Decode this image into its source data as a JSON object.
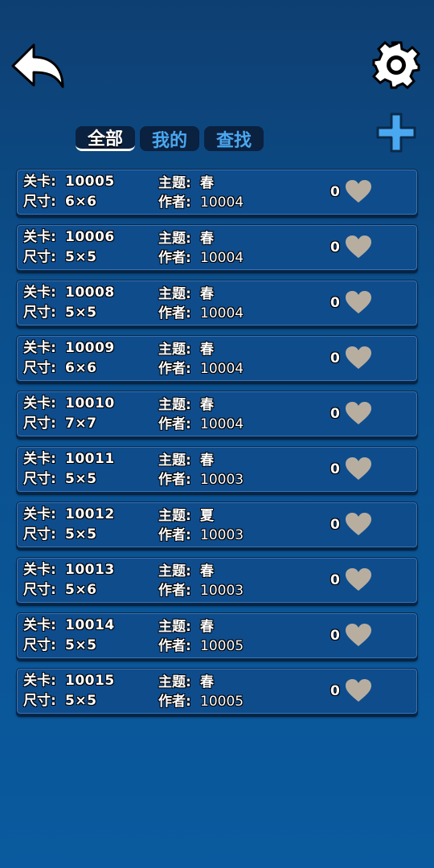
{
  "header": {
    "back_icon": "back-arrow-icon",
    "settings_icon": "gear-icon",
    "add_icon": "plus-icon"
  },
  "tabs": [
    {
      "label": "全部",
      "active": true
    },
    {
      "label": "我的",
      "active": false
    },
    {
      "label": "查找",
      "active": false
    }
  ],
  "labels": {
    "level": "关卡:",
    "size": "尺寸:",
    "theme": "主题:",
    "author": "作者:"
  },
  "levels": [
    {
      "id": "10005",
      "size": "6×6",
      "theme": "春",
      "author": "10004",
      "likes": "0"
    },
    {
      "id": "10006",
      "size": "5×5",
      "theme": "春",
      "author": "10004",
      "likes": "0"
    },
    {
      "id": "10008",
      "size": "5×5",
      "theme": "春",
      "author": "10004",
      "likes": "0"
    },
    {
      "id": "10009",
      "size": "6×6",
      "theme": "春",
      "author": "10004",
      "likes": "0"
    },
    {
      "id": "10010",
      "size": "7×7",
      "theme": "春",
      "author": "10004",
      "likes": "0"
    },
    {
      "id": "10011",
      "size": "5×5",
      "theme": "春",
      "author": "10003",
      "likes": "0"
    },
    {
      "id": "10012",
      "size": "5×5",
      "theme": "夏",
      "author": "10003",
      "likes": "0"
    },
    {
      "id": "10013",
      "size": "5×6",
      "theme": "春",
      "author": "10003",
      "likes": "0"
    },
    {
      "id": "10014",
      "size": "5×5",
      "theme": "春",
      "author": "10005",
      "likes": "0"
    },
    {
      "id": "10015",
      "size": "5×5",
      "theme": "春",
      "author": "10005",
      "likes": "0"
    }
  ],
  "colors": {
    "background": "#0b4f8c",
    "card": "#0f4c8c",
    "tab_inactive_text": "#4aa8f0",
    "heart": "#b8aea0",
    "plus": "#4aa8f0"
  }
}
